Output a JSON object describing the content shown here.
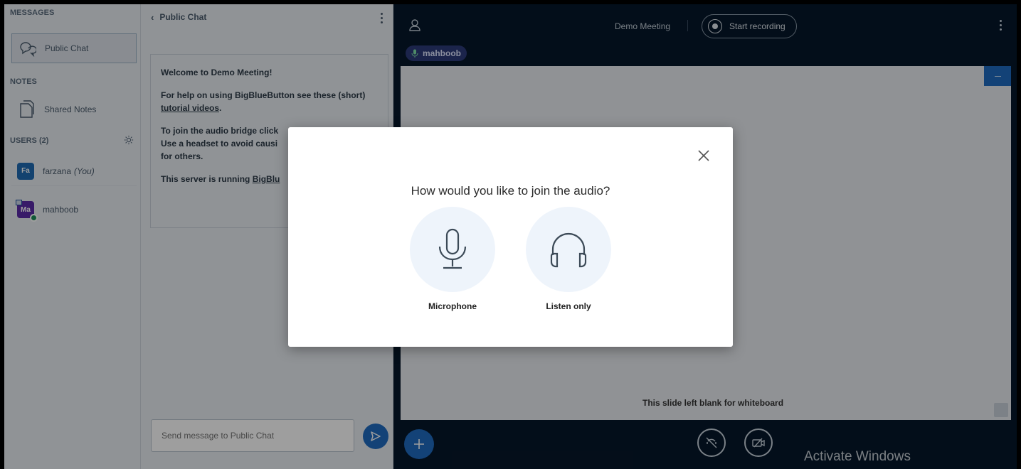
{
  "sidebar": {
    "messages_header": "MESSAGES",
    "public_chat_label": "Public Chat",
    "notes_header": "NOTES",
    "shared_notes_label": "Shared Notes",
    "users_header": "USERS (2)",
    "users": [
      {
        "initials": "Fa",
        "name": "farzana",
        "suffix": "(You)"
      },
      {
        "initials": "Ma",
        "name": "mahboob"
      }
    ]
  },
  "chat": {
    "title": "Public Chat",
    "welcome": "Welcome to Demo Meeting!",
    "help_line_1": "For help on using BigBlueButton see these (short) ",
    "help_link": "tutorial videos",
    "help_line_end": ".",
    "audio_line_1": "To join the audio bridge click",
    "audio_line_2": "Use a headset to avoid causi",
    "audio_line_3": "for others.",
    "server_line": "This server is running ",
    "server_link": "BigBlu",
    "input_placeholder": "Send message to Public Chat"
  },
  "main": {
    "meeting_title": "Demo Meeting",
    "record_label": "Start recording",
    "talking_user": "mahboob",
    "slide_text": "This slide left blank for whiteboard",
    "watermark": "Activate Windows"
  },
  "modal": {
    "title": "How would you like to join the audio?",
    "microphone_label": "Microphone",
    "listen_label": "Listen only"
  },
  "colors": {
    "accent": "#1f6bc0",
    "background": "#06172a",
    "sidebar": "#e9edf2"
  }
}
